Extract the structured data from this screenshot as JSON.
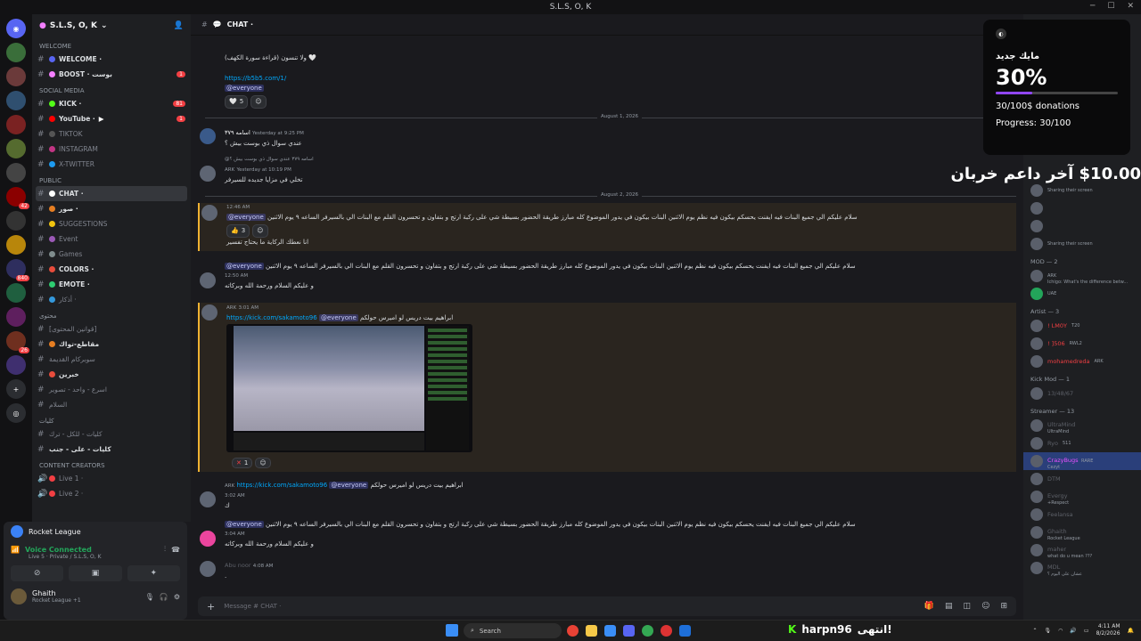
{
  "window": {
    "title": "S.L.S, O, K"
  },
  "servers": [
    {
      "badge": ""
    },
    {
      "badge": ""
    },
    {
      "badge": ""
    },
    {
      "badge": ""
    },
    {
      "badge": ""
    },
    {
      "badge": ""
    },
    {
      "badge": ""
    },
    {
      "badge": "42"
    },
    {
      "badge": ""
    },
    {
      "badge": ""
    },
    {
      "badge": "840"
    },
    {
      "badge": ""
    },
    {
      "badge": ""
    },
    {
      "badge": "26"
    },
    {
      "badge": ""
    }
  ],
  "guild": {
    "name": "S.L.S, O, K"
  },
  "channels": {
    "cat_welcome": "WELCOME",
    "welcome": "WELCOME ·",
    "boost": "BOOST · بوست",
    "boost_count": "1",
    "cat_social": "Social Media",
    "kick": "KICK ·",
    "kick_count": "81",
    "youtube": "YouTube ·",
    "youtube_count": "1",
    "tiktok": "TIKTOK",
    "instagram": "INSTAGRAM",
    "xtwitter": "X-TWITTER",
    "cat_public": "PUBLIC",
    "chat": "CHAT ·",
    "suwar": "صور ·",
    "suggestions": "SUGGESTIONS",
    "event": "Event",
    "games": "Games",
    "colors": "COLORS ·",
    "emote": "EMOTE ·",
    "adhkar": "أذكار ·",
    "cat_content": "محتوى",
    "ch_q1": "[قوانين المحتوى]",
    "ch_q2": "مقاطع-تواك",
    "ch_q3": "سوبركام القديمة",
    "ch_q4": "خبرين",
    "ch_q5": "اسرع - واحد - تصوير",
    "ch_q6": "السلام",
    "cat_kaliyat": "كليات",
    "ch_k1": "كليات - للكل - ترك",
    "ch_k2": "كليات - على - جنب",
    "cat_creators": "CONTENT CREATORS",
    "live1": "Live 1 ·",
    "live2": "Live 2 ·"
  },
  "voice": {
    "activity": "Rocket League",
    "status": "Voice Connected",
    "location": "Live 5 · Private / S.L.S, O, K",
    "user": "Ghaith",
    "user_sub": "Rocket League +1"
  },
  "chat_header": {
    "channel": "CHAT ·"
  },
  "messages": {
    "m0_line1": "ولا تنسون (قراءة سورة الكهف) 🤍",
    "m0_link": "https://b5b5.com/1/",
    "m0_mention": "@everyone",
    "m0_react": "5",
    "date1": "August 1, 2026",
    "m1_name": "اسامه ٣٧٩",
    "m1_time": "Yesterday at 9:25 PM",
    "m1_text": "عندي سوال ذي بوست بيش ؟",
    "m2_reply": "@اسامه ٣٧٩ عندي سوال ذي بوست بيش ؟",
    "m2_tag": "ARK",
    "m2_time": "Yesterday at 10:19 PM",
    "m2_text": "تخلي في مزايا جديده للسيرفر",
    "date2": "August 2, 2026",
    "m3_time": "12:46 AM",
    "m3_mention": "@everyone",
    "m3_text": "سلام عليكم الي جميع البنات فيه ايفنت يحسكم بيكون فيه نظم يوم الاثنين البنات بيكون في يدور الموضوع كله مبارز طريقة الحضور بسيطة شي على ركبة ارتج و بتفاون و تحسرون القلم مع البنات الي بالسيرفر الساعه ٩ يوم الاثنين",
    "m3_react": "3",
    "m3_sub": "انا نعطك الركاية ما يحتاج تفسير",
    "m4_mention": "@everyone",
    "m4_text": "سلام عليكم الي جميع البنات فيه ايفنت يحسكم بيكون فيه نظم يوم الاثنين البنات بيكون في يدور الموضوع كله مبارز طريقة الحضور بسيطة شي على ركبة ارتج و بتفاون و تحسرون القلم مع البنات الي بالسيرفر الساعه ٩ يوم الاثنين",
    "m4_time": "12:50 AM",
    "m4_sub": "و عليكم السلام ورحمة الله وبركاته",
    "m5_tag": "ARK",
    "m5_time": "3:01 AM",
    "m5_link": "https://kick.com/sakamoto96",
    "m5_mention": "@everyone",
    "m5_text": "ابراهيم بيت دريس لو اميرس حولكم",
    "m5_react": "1",
    "m6_tag": "ARK",
    "m6_link": "https://kick.com/sakamoto96",
    "m6_mention": "@everyone",
    "m6_text": "ابراهيم بيت دريس لو اميرس حولكم",
    "m6_time": "3:02 AM",
    "m6_sub": "ك",
    "m7_mention": "@everyone",
    "m7_text": "سلام عليكم الي جميع البنات فيه ايفنت يحسكم بيكون فيه نظم يوم الاثنين البنات بيكون في يدور الموضوع كله مبارز طريقة الحضور بسيطة شي على ركبة ارتج و بتفاون و تحسرون القلم مع البنات الي بالسيرفر الساعه ٩ يوم الاثنين",
    "m7_time": "3:04 AM",
    "m7_sub": "و عليكم السلام ورحمة الله وبركاته",
    "m8_name": "Abu noor",
    "m8_time": "4:08 AM",
    "m8_sub": "."
  },
  "composer": {
    "placeholder": "Message # CHAT ·"
  },
  "members": {
    "s1": "Sharing their screen",
    "s2": "Sharing their screen",
    "mod_cat": "MOD — 2",
    "mod1_tag": "ARK",
    "mod1_sub": "Ichigo: What's the difference betw...",
    "mod2_tag": "UAE",
    "artist_cat": "Artist — 3",
    "a1": "! LM0Y",
    "a1_tag": "T20",
    "a2": "! ]506",
    "a2_tag": "RWL2",
    "a3": "mohamedreda",
    "a3_tag": "ARK",
    "kickmod_cat": "Kick Mod — 1",
    "k1": "13/48/67",
    "streamer_cat": "Streamer — 13",
    "st1": "UltraMind",
    "st1_sub": "UltraMind",
    "st2": "Ryo",
    "st2_tag": "511",
    "st3": "CrazyBugs",
    "st3_tag": "RARE",
    "st3_sub": "Cezyt",
    "st4": "DTM",
    "st5": "Evergy",
    "st5_sub": "+Respect",
    "st6": "Feelansa",
    "st7": "Ghaith",
    "st7_sub": "Rocket League",
    "st8": "maher",
    "st8_sub": "what do u mean ???",
    "st9": "MDL",
    "st9_sub": "عشان على اليوم ؟"
  },
  "overlay": {
    "title": "مايك جديد",
    "percent": "30%",
    "progress_fraction": 0.3,
    "donations": "30/100$ donations",
    "progress": "Progress: 30/100"
  },
  "ticker": {
    "text": "$10.00 آخر داعم خربان"
  },
  "taskbar": {
    "search": "Search"
  },
  "kick_overlay": {
    "user": "harpn96",
    "text": "انتهى!"
  },
  "tray": {
    "time": "4:11 AM",
    "date": "8/2/2026"
  }
}
